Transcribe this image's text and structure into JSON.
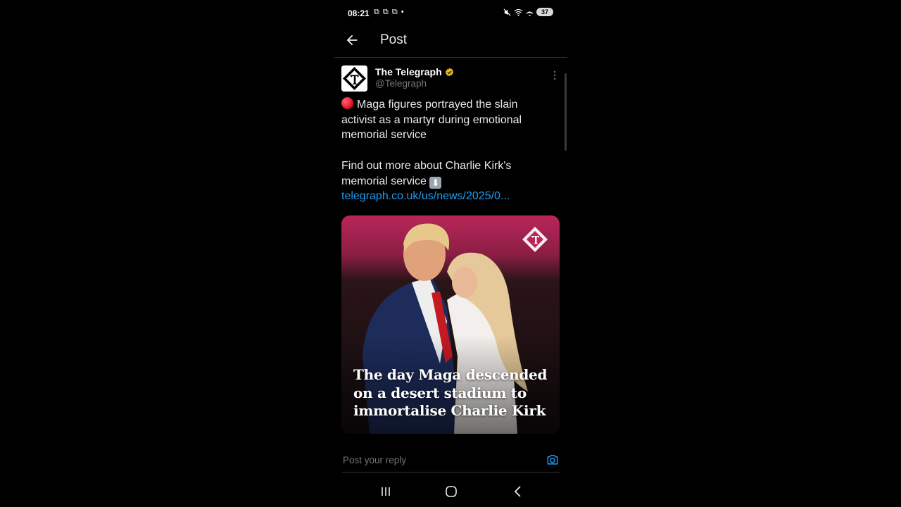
{
  "status_bar": {
    "time": "08:21",
    "notification_icons": "⧉ ⧉ ⧉ •",
    "battery": "37"
  },
  "header": {
    "title": "Post"
  },
  "post": {
    "author_name": "The Telegraph",
    "author_handle": "@Telegraph",
    "text_line_1": "Maga figures portrayed the slain activist as a martyr during emotional memorial service",
    "text_line_2": "Find out more about Charlie Kirk's memorial service",
    "down_arrow": "⬇",
    "link": "telegraph.co.uk/us/news/2025/0...",
    "media_headline": "The day Maga descended on a desert stadium to immortalise Charlie Kirk"
  },
  "reply": {
    "placeholder": "Post your reply"
  },
  "colors": {
    "background": "#000000",
    "link": "#1d9bf0",
    "muted": "#71767b",
    "verified": "#e2b719",
    "accent_pink": "#b8265a"
  },
  "icons": {
    "back": "arrow-left-icon",
    "verified": "verified-badge-icon",
    "more": "more-vertical-icon",
    "camera": "camera-icon",
    "nav_recents": "recents-icon",
    "nav_home": "home-circle-icon",
    "nav_back": "chevron-left-icon"
  }
}
